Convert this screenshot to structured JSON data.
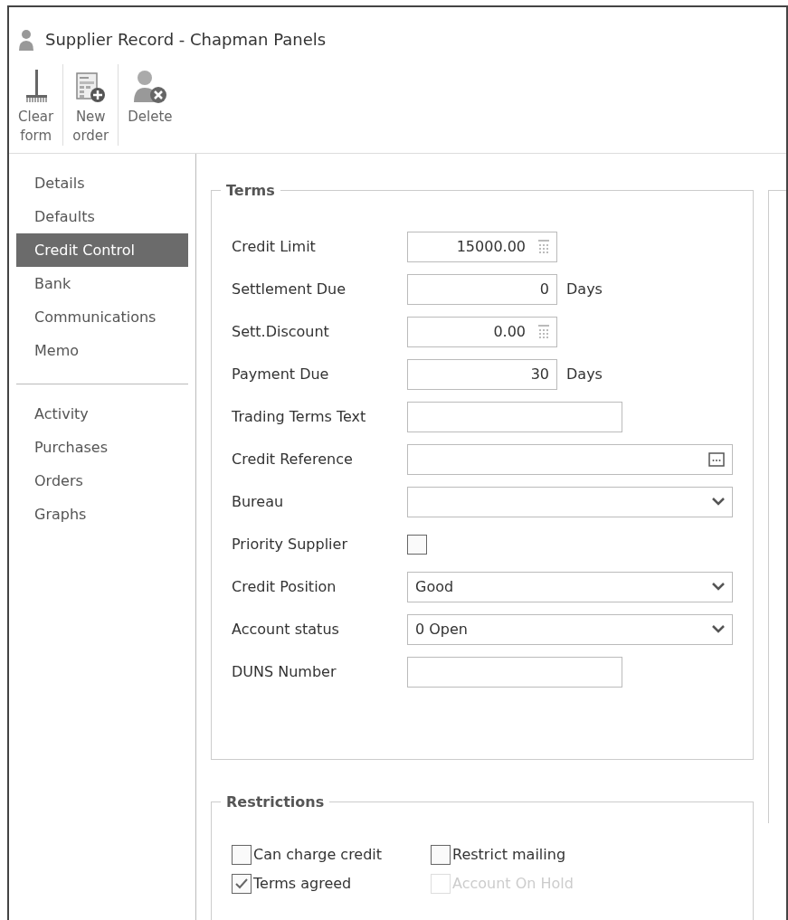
{
  "window": {
    "title": "Supplier Record - Chapman Panels"
  },
  "toolbar": [
    {
      "kind": "broom",
      "label": "Clear\nform"
    },
    {
      "kind": "new-order",
      "label": "New\norder"
    },
    {
      "kind": "delete-person",
      "label": "Delete"
    }
  ],
  "sidebar": {
    "groups": [
      [
        {
          "label": "Details",
          "selected": false
        },
        {
          "label": "Defaults",
          "selected": false
        },
        {
          "label": "Credit Control",
          "selected": true
        },
        {
          "label": "Bank",
          "selected": false
        },
        {
          "label": "Communications",
          "selected": false
        },
        {
          "label": "Memo",
          "selected": false
        }
      ],
      [
        {
          "label": "Activity",
          "selected": false
        },
        {
          "label": "Purchases",
          "selected": false
        },
        {
          "label": "Orders",
          "selected": false
        },
        {
          "label": "Graphs",
          "selected": false
        }
      ]
    ]
  },
  "terms": {
    "title": "Terms",
    "fields": [
      {
        "label": "Credit Limit",
        "kind": "calc",
        "value": "15000.00"
      },
      {
        "label": "Settlement Due",
        "kind": "days",
        "value": "0",
        "suffix": "Days"
      },
      {
        "label": "Sett.Discount",
        "kind": "calc",
        "value": "0.00"
      },
      {
        "label": "Payment Due",
        "kind": "days",
        "value": "30",
        "suffix": "Days"
      },
      {
        "label": "Trading Terms Text",
        "kind": "text"
      },
      {
        "label": "Credit Reference",
        "kind": "ellipsis"
      },
      {
        "label": "Bureau",
        "kind": "dropdown"
      },
      {
        "label": "Priority Supplier",
        "kind": "checkbox",
        "checked": false
      },
      {
        "label": "Credit Position",
        "kind": "dropdown",
        "value": "Good"
      },
      {
        "label": "Account status",
        "kind": "dropdown",
        "value": "0 Open"
      },
      {
        "label": "DUNS Number",
        "kind": "text"
      }
    ]
  },
  "restrictions": {
    "title": "Restrictions",
    "options": [
      {
        "label": "Can charge credit",
        "checked": false,
        "disabled": false
      },
      {
        "label": "Restrict mailing",
        "checked": false,
        "disabled": false
      },
      {
        "label": "Terms agreed",
        "checked": true,
        "disabled": false
      },
      {
        "label": "Account On Hold",
        "checked": false,
        "disabled": true
      }
    ]
  }
}
